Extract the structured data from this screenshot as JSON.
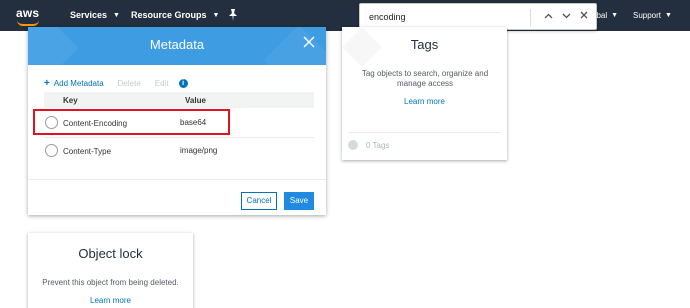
{
  "nav": {
    "logo": "aws",
    "services": "Services",
    "resource_groups": "Resource Groups",
    "region": "Global",
    "region_visible": "obal",
    "support": "Support"
  },
  "find": {
    "query": "encoding",
    "prev_icon": "chevron-up-icon",
    "next_icon": "chevron-down-icon",
    "close_icon": "close-icon"
  },
  "metadata_modal": {
    "title": "Metadata",
    "add_label": "Add Metadata",
    "delete_label": "Delete",
    "edit_label": "Edit",
    "columns": [
      "Key",
      "Value"
    ],
    "rows": [
      {
        "key": "Content-Encoding",
        "value": "base64",
        "highlighted": true
      },
      {
        "key": "Content-Type",
        "value": "image/png",
        "highlighted": false
      }
    ],
    "cancel_label": "Cancel",
    "save_label": "Save"
  },
  "tags_card": {
    "title": "Tags",
    "description": "Tag objects to search, organize and manage access",
    "learn_more": "Learn more",
    "count_label": "0 Tags"
  },
  "object_lock_card": {
    "title": "Object lock",
    "description": "Prevent this object from being deleted.",
    "learn_more": "Learn more"
  },
  "colors": {
    "nav_bg": "#232f3e",
    "modal_header": "#3d9ce2",
    "link": "#0073bb",
    "primary_button": "#1f8ae0",
    "highlight_border": "#e0141e"
  }
}
